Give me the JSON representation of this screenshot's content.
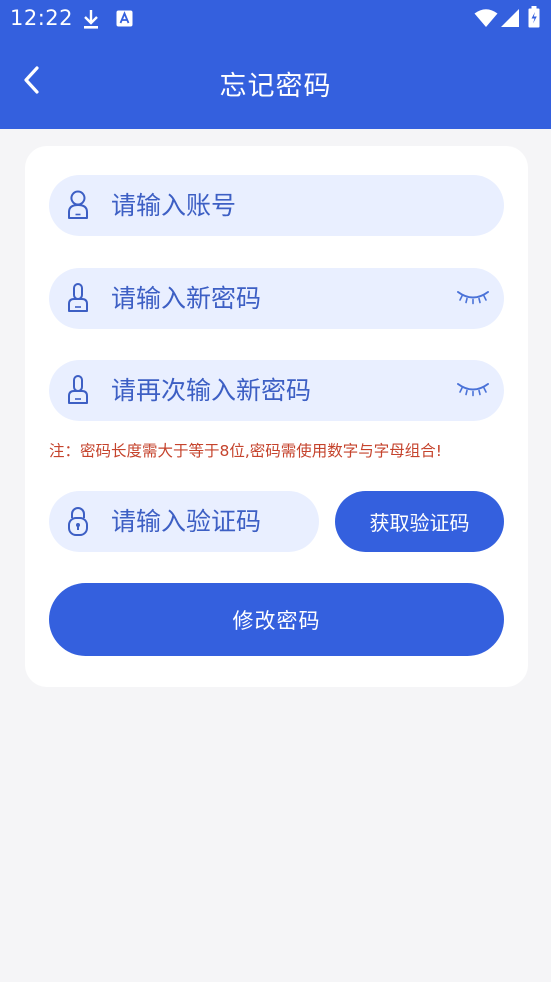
{
  "status_bar": {
    "time": "12:22",
    "icons": [
      "download-icon",
      "a-notification-icon",
      "wifi-icon",
      "signal-icon",
      "battery-icon"
    ]
  },
  "nav": {
    "title": "忘记密码",
    "back_icon": "chevron-left-icon"
  },
  "form": {
    "account": {
      "placeholder": "请输入账号",
      "icon": "person-icon"
    },
    "new_password": {
      "placeholder": "请输入新密码",
      "icon": "key-icon",
      "toggle_icon": "eye-closed-icon"
    },
    "confirm_password": {
      "placeholder": "请再次输入新密码",
      "icon": "key-icon",
      "toggle_icon": "eye-closed-icon"
    },
    "note": "注：密码长度需大于等于8位,密码需使用数字与字母组合!",
    "verify_code": {
      "placeholder": "请输入验证码",
      "icon": "lock-icon"
    },
    "get_code_label": "获取验证码",
    "submit_label": "修改密码"
  },
  "colors": {
    "brand": "#3460de",
    "field_bg": "#e9efff",
    "note": "#c5432c",
    "page_bg": "#f5f5f7"
  }
}
